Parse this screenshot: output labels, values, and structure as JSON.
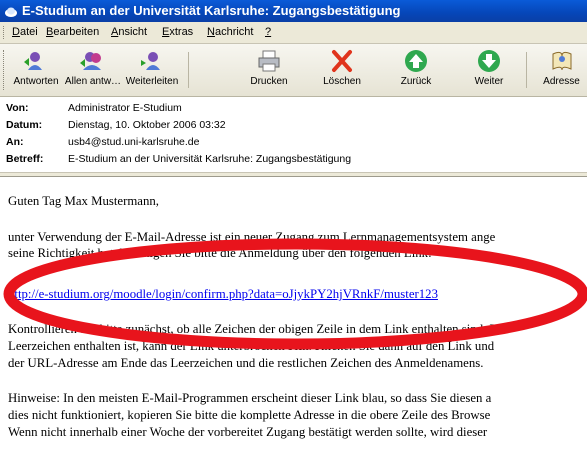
{
  "window": {
    "title": "E-Studium an der Universität Karlsruhe: Zugangsbestätigung"
  },
  "menu": {
    "items": [
      {
        "label": "Datei",
        "ul_index": 0
      },
      {
        "label": "Bearbeiten",
        "ul_index": 0
      },
      {
        "label": "Ansicht",
        "ul_index": 0
      },
      {
        "label": "Extras",
        "ul_index": 0
      },
      {
        "label": "Nachricht",
        "ul_index": 0
      },
      {
        "label": "?",
        "ul_index": 0
      }
    ]
  },
  "toolbar": {
    "reply": "Antworten",
    "reply_all": "Allen antw…",
    "forward": "Weiterleiten",
    "print": "Drucken",
    "delete": "Löschen",
    "back": "Zurück",
    "next": "Weiter",
    "addresses": "Adresse"
  },
  "header": {
    "from_label": "Von:",
    "from": "Administrator E-Studium",
    "date_label": "Datum:",
    "date": "Dienstag, 10. Oktober 2006 03:32",
    "to_label": "An:",
    "to": "usb4@stud.uni-karlsruhe.de",
    "subject_label": "Betreff:",
    "subject": "E-Studium an der Universität Karlsruhe: Zugangsbestätigung"
  },
  "message": {
    "greeting": "Guten Tag Max Mustermann,",
    "p1_line1": "unter Verwendung der E-Mail-Adresse ist ein neuer Zugang zum Lernmanagementsystem ange",
    "p1_line2": "seine Richtigkeit hat, bestätigen Sie bitte die Anmeldung über den folgenden Link:",
    "link": "http://e-studium.org/moodle/login/confirm.php?data=oJjykPY2hjVRnkF/muster123",
    "p2_line1": "Kontrollieren Sie bitte zunächst, ob alle Zeichen der obigen Zeile in dem Link enthalten sind. F",
    "p2_line2": "Leerzeichen enthalten ist, kann der Link unterbrochen sein. Klicken Sie dann auf den Link und",
    "p2_line3": "der URL-Adresse am Ende das Leerzeichen und die restlichen Zeichen des Anmeldenamens.",
    "p3_line1": "Hinweise: In den meisten E-Mail-Programmen erscheint dieser Link blau, so dass Sie diesen a",
    "p3_line2": "dies nicht funktioniert, kopieren Sie bitte die komplette Adresse in die obere Zeile des Browse",
    "p3_line3": "Wenn nicht innerhalb einer Woche der vorbereitet Zugang bestätigt werden sollte, wird dieser"
  },
  "colors": {
    "annotation": "#e8141c",
    "link": "#0000ee",
    "titlebar": "#0a5bd8"
  }
}
